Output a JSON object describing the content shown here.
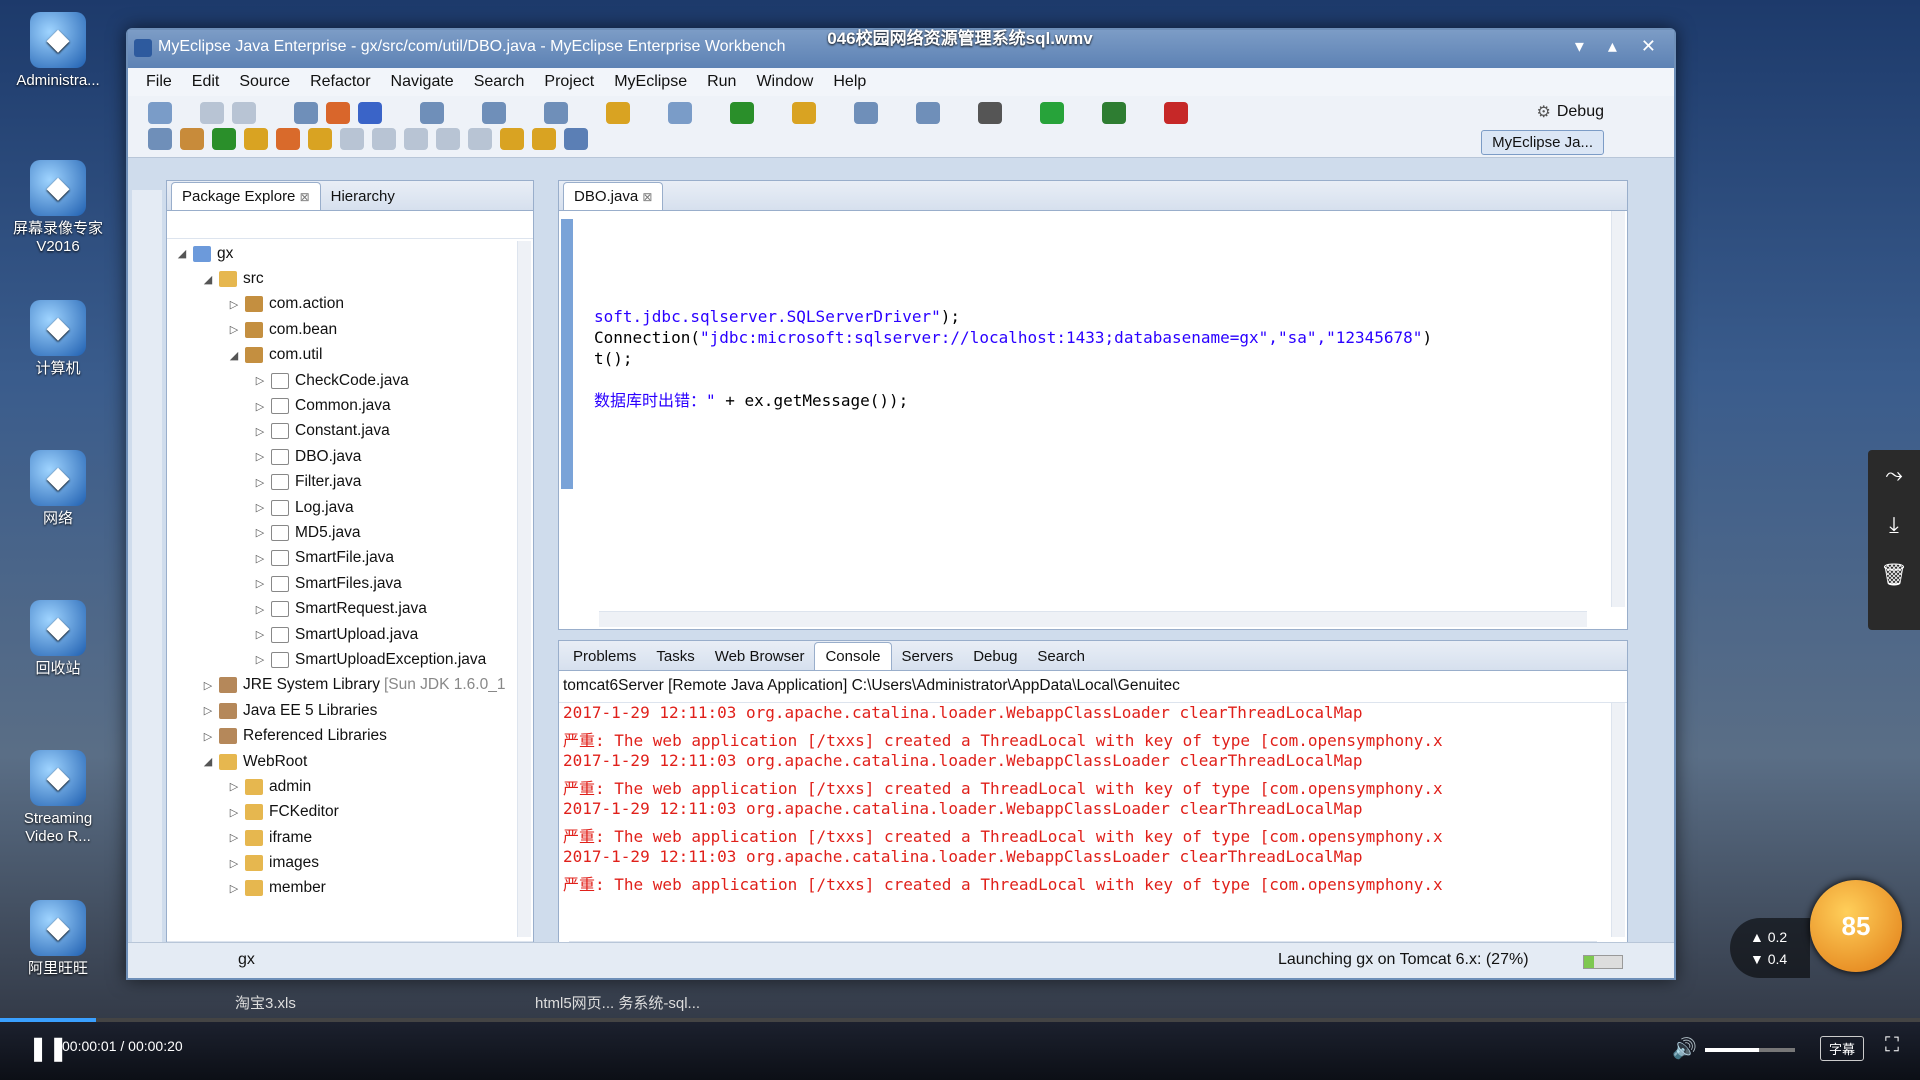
{
  "video_title": "046校园网络资源管理系统sql.wmv",
  "desktop_icons": [
    {
      "label": "Administra...",
      "icon": "user-icon"
    },
    {
      "label": "屏幕录像专家V2016",
      "icon": "recorder-icon"
    },
    {
      "label": "计算机",
      "icon": "computer-icon"
    },
    {
      "label": "网络",
      "icon": "network-icon"
    },
    {
      "label": "回收站",
      "icon": "recycle-bin-icon"
    },
    {
      "label": "Streaming Video R...",
      "icon": "streaming-icon"
    },
    {
      "label": "阿里旺旺",
      "icon": "chat-icon"
    }
  ],
  "window": {
    "title": "MyEclipse Java Enterprise - gx/src/com/util/DBO.java - MyEclipse Enterprise Workbench",
    "menu": [
      "File",
      "Edit",
      "Source",
      "Refactor",
      "Navigate",
      "Search",
      "Project",
      "MyEclipse",
      "Run",
      "Window",
      "Help"
    ],
    "perspective_debug": "Debug",
    "perspective_myeclipse": "MyEclipse Ja..."
  },
  "package_explorer": {
    "tab_label": "Package Explore",
    "hierarchy_tab": "Hierarchy",
    "tree": [
      {
        "label": "gx",
        "kind": "project",
        "indent": 0,
        "expanded": true
      },
      {
        "label": "src",
        "kind": "folder",
        "indent": 1,
        "expanded": true
      },
      {
        "label": "com.action",
        "kind": "package",
        "indent": 2,
        "expanded": false
      },
      {
        "label": "com.bean",
        "kind": "package",
        "indent": 2,
        "expanded": false
      },
      {
        "label": "com.util",
        "kind": "package",
        "indent": 2,
        "expanded": true
      },
      {
        "label": "CheckCode.java",
        "kind": "java",
        "indent": 3,
        "expanded": false
      },
      {
        "label": "Common.java",
        "kind": "java",
        "indent": 3,
        "expanded": false
      },
      {
        "label": "Constant.java",
        "kind": "java",
        "indent": 3,
        "expanded": false
      },
      {
        "label": "DBO.java",
        "kind": "java",
        "indent": 3,
        "expanded": false
      },
      {
        "label": "Filter.java",
        "kind": "java",
        "indent": 3,
        "expanded": false
      },
      {
        "label": "Log.java",
        "kind": "java",
        "indent": 3,
        "expanded": false
      },
      {
        "label": "MD5.java",
        "kind": "java",
        "indent": 3,
        "expanded": false
      },
      {
        "label": "SmartFile.java",
        "kind": "java",
        "indent": 3,
        "expanded": false
      },
      {
        "label": "SmartFiles.java",
        "kind": "java",
        "indent": 3,
        "expanded": false
      },
      {
        "label": "SmartRequest.java",
        "kind": "java",
        "indent": 3,
        "expanded": false
      },
      {
        "label": "SmartUpload.java",
        "kind": "java",
        "indent": 3,
        "expanded": false
      },
      {
        "label": "SmartUploadException.java",
        "kind": "java",
        "indent": 3,
        "expanded": false
      },
      {
        "label": "JRE System Library",
        "extra": "[Sun JDK 1.6.0_1",
        "kind": "lib",
        "indent": 1,
        "expanded": false
      },
      {
        "label": "Java EE 5 Libraries",
        "kind": "lib",
        "indent": 1,
        "expanded": false
      },
      {
        "label": "Referenced Libraries",
        "kind": "lib",
        "indent": 1,
        "expanded": false
      },
      {
        "label": "WebRoot",
        "kind": "folder",
        "indent": 1,
        "expanded": true
      },
      {
        "label": "admin",
        "kind": "folder",
        "indent": 2,
        "expanded": false
      },
      {
        "label": "FCKeditor",
        "kind": "folder",
        "indent": 2,
        "expanded": false
      },
      {
        "label": "iframe",
        "kind": "folder",
        "indent": 2,
        "expanded": false
      },
      {
        "label": "images",
        "kind": "folder",
        "indent": 2,
        "expanded": false
      },
      {
        "label": "member",
        "kind": "folder",
        "indent": 2,
        "expanded": false
      }
    ]
  },
  "editor": {
    "tab_label": "DBO.java",
    "lines": [
      {
        "segments": [
          {
            "t": "soft.jdbc.sqlserver.SQLServerDriver\"",
            "c": "str"
          },
          {
            "t": ");",
            "c": "plain"
          }
        ]
      },
      {
        "segments": [
          {
            "t": "Connection(",
            "c": "plain"
          },
          {
            "t": "\"jdbc:microsoft:sqlserver://localhost:1433;databasename=gx\",\"sa\",\"12345678\"",
            "c": "str"
          },
          {
            "t": ")",
            "c": "plain"
          }
        ]
      },
      {
        "segments": [
          {
            "t": "t();",
            "c": "plain"
          }
        ]
      },
      {
        "segments": [
          {
            "t": "数据库时出错：\"",
            "c": "str"
          },
          {
            "t": " + ex.getMessage());",
            "c": "plain"
          }
        ]
      }
    ]
  },
  "console": {
    "tabs": [
      "Problems",
      "Tasks",
      "Web Browser",
      "Console",
      "Servers",
      "Debug",
      "Search"
    ],
    "active_tab": "Console",
    "header": "tomcat6Server [Remote Java Application] C:\\Users\\Administrator\\AppData\\Local\\Genuitec",
    "lines": [
      "2017-1-29 12:11:03 org.apache.catalina.loader.WebappClassLoader clearThreadLocalMap",
      "严重: The web application [/txxs] created a ThreadLocal with key of type [com.opensymphony.x",
      "2017-1-29 12:11:03 org.apache.catalina.loader.WebappClassLoader clearThreadLocalMap",
      "严重: The web application [/txxs] created a ThreadLocal with key of type [com.opensymphony.x",
      "2017-1-29 12:11:03 org.apache.catalina.loader.WebappClassLoader clearThreadLocalMap",
      "严重: The web application [/txxs] created a ThreadLocal with key of type [com.opensymphony.x",
      "2017-1-29 12:11:03 org.apache.catalina.loader.WebappClassLoader clearThreadLocalMap",
      "严重: The web application [/txxs] created a ThreadLocal with key of type [com.opensymphony.x"
    ]
  },
  "status": {
    "left": "gx",
    "right": "Launching gx on Tomcat 6.x: (27%)",
    "progress": 0.27
  },
  "taskbar_hint": {
    "left": "淘宝3.xls",
    "right": "html5网页... 务系统-sql..."
  },
  "player": {
    "time": "00:00:01 / 00:00:20",
    "progress": 0.05,
    "subtitle_btn": "字幕",
    "volume": 0.6,
    "badge": "85",
    "speed_up": "0.2",
    "speed_down": "0.4"
  },
  "colors": {
    "accent": "#3aa0ff",
    "console_error": "#e0201a",
    "code_string": "#2a00ff"
  }
}
